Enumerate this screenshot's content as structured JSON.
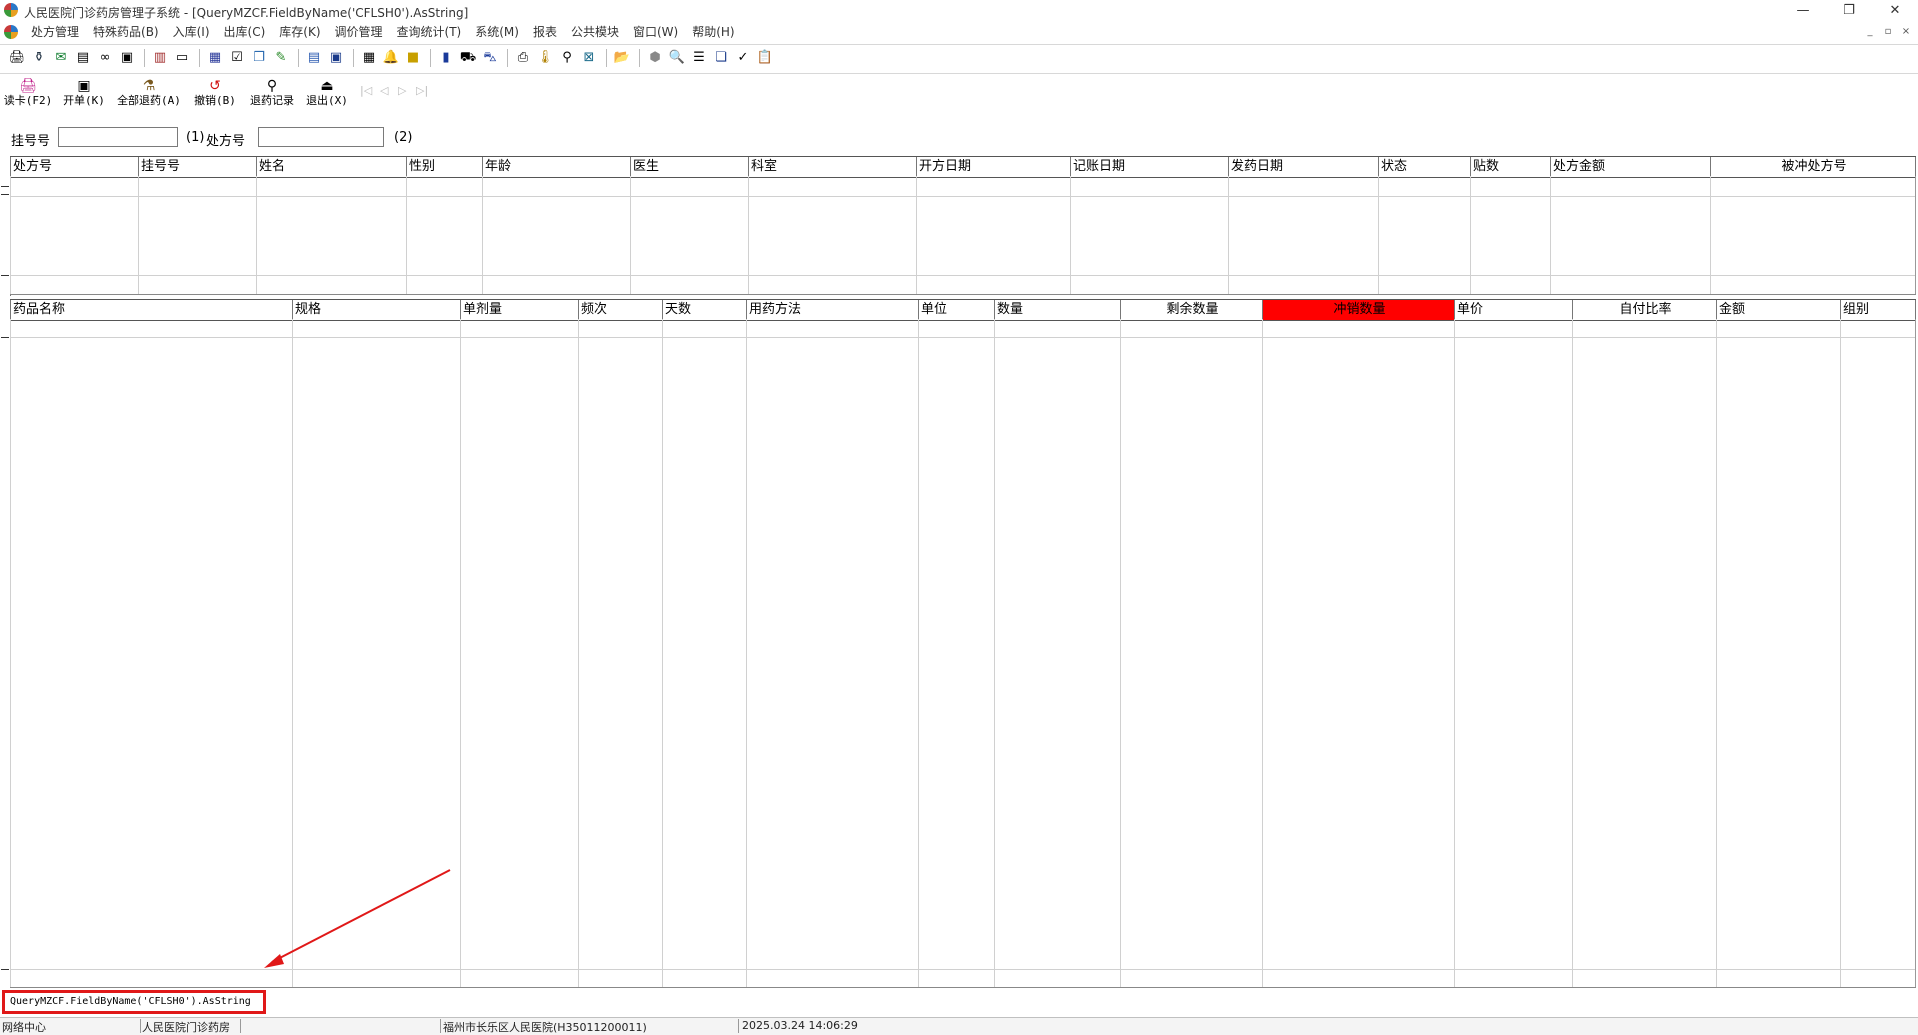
{
  "window": {
    "title": "人民医院门诊药房管理子系统 - [QueryMZCF.FieldByName('CFLSH0').AsString]",
    "minimize": "—",
    "restore": "❐",
    "close": "✕"
  },
  "menu": [
    "处方管理",
    "特殊药品(B)",
    "入库(I)",
    "出库(C)",
    "库存(K)",
    "调价管理",
    "查询统计(T)",
    "系统(M)",
    "报表",
    "公共模块",
    "窗口(W)",
    "帮助(H)"
  ],
  "mdi": {
    "min": "_",
    "restore": "▫",
    "close": "×"
  },
  "toolbar_icons": [
    "card-reader-icon",
    "drug-bottle-icon",
    "mail-icon",
    "document-icon",
    "binoculars-icon",
    "stamp-icon",
    "book-icon",
    "id-card-icon",
    "report-icon",
    "check-icon",
    "copy-icon",
    "edit-icon",
    "notebook-icon",
    "monitor-icon",
    "grid-icon",
    "bell-icon",
    "yellow-box-icon",
    "bin-icon",
    "truck-icon",
    "cart-icon",
    "printer-icon",
    "thermometer-icon",
    "magnifier-icon",
    "calculator-icon",
    "folder-icon",
    "globe-icon",
    "zoom-icon",
    "list-icon",
    "window-icon",
    "check-form-icon",
    "clipboard-icon"
  ],
  "actions": {
    "read_card": "读卡(F2)",
    "open_bill": "开单(K)",
    "all_return": "全部退药(A)",
    "cancel": "撤销(B)",
    "return_records": "退药记录",
    "exit": "退出(X)"
  },
  "query": {
    "reg_label": "挂号号",
    "reg_suffix": "(1)",
    "rx_label": "处方号",
    "rx_suffix": "(2)",
    "reg_value": "",
    "rx_value": ""
  },
  "rx_table": {
    "columns": [
      "处方号",
      "挂号号",
      "姓名",
      "性别",
      "年龄",
      "医生",
      "科室",
      "开方日期",
      "记账日期",
      "发药日期",
      "状态",
      "贴数",
      "处方金额",
      "被冲处方号"
    ],
    "rows": []
  },
  "drug_table": {
    "columns": [
      "药品名称",
      "规格",
      "单剂量",
      "频次",
      "天数",
      "用药方法",
      "单位",
      "数量",
      "剩余数量",
      "冲销数量",
      "单价",
      "自付比率",
      "金额",
      "组别"
    ],
    "highlight_column": "冲销数量",
    "highlight_color": "#ff0000",
    "rows": []
  },
  "hint": "QueryMZCF.FieldByName('CFLSH0').AsString",
  "status": {
    "network": "网络中心",
    "department": "人民医院门诊药房",
    "hospital": "福州市长乐区人民医院(H35011200011)",
    "datetime": "2025.03.24 14:06:29"
  },
  "colors": {
    "annotation": "#e01818"
  }
}
